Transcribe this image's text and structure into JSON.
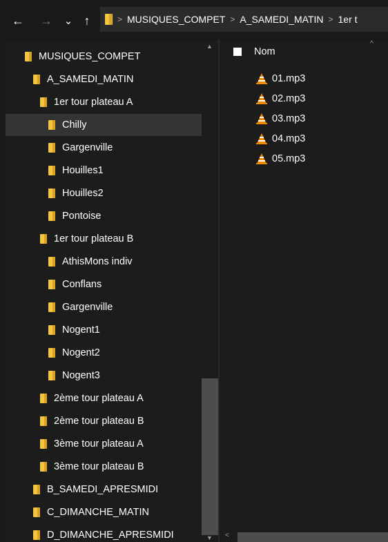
{
  "nav": {
    "back_icon": "←",
    "forward_icon": "→",
    "recent_icon": "⌄",
    "up_icon": "↑"
  },
  "breadcrumb": [
    {
      "label": "MUSIQUES_COMPET"
    },
    {
      "label": "A_SAMEDI_MATIN"
    },
    {
      "label": "1er t"
    }
  ],
  "tree": {
    "items": [
      {
        "label": "MUSIQUES_COMPET",
        "depth": 0,
        "selected": false
      },
      {
        "label": "A_SAMEDI_MATIN",
        "depth": 1,
        "selected": false
      },
      {
        "label": "1er tour plateau A",
        "depth": 2,
        "selected": false
      },
      {
        "label": "Chilly",
        "depth": 3,
        "selected": true
      },
      {
        "label": "Gargenville",
        "depth": 3,
        "selected": false
      },
      {
        "label": "Houilles1",
        "depth": 3,
        "selected": false
      },
      {
        "label": "Houilles2",
        "depth": 3,
        "selected": false
      },
      {
        "label": "Pontoise",
        "depth": 3,
        "selected": false
      },
      {
        "label": "1er tour plateau B",
        "depth": 2,
        "selected": false
      },
      {
        "label": "AthisMons indiv",
        "depth": 3,
        "selected": false
      },
      {
        "label": "Conflans",
        "depth": 3,
        "selected": false
      },
      {
        "label": "Gargenville",
        "depth": 3,
        "selected": false
      },
      {
        "label": "Nogent1",
        "depth": 3,
        "selected": false
      },
      {
        "label": "Nogent2",
        "depth": 3,
        "selected": false
      },
      {
        "label": "Nogent3",
        "depth": 3,
        "selected": false
      },
      {
        "label": "2ème tour plateau A",
        "depth": 2,
        "selected": false
      },
      {
        "label": "2ème tour plateau B",
        "depth": 2,
        "selected": false
      },
      {
        "label": "3ème tour plateau A",
        "depth": 2,
        "selected": false
      },
      {
        "label": "3ème tour plateau B",
        "depth": 2,
        "selected": false
      },
      {
        "label": "B_SAMEDI_APRESMIDI",
        "depth": 1,
        "selected": false
      },
      {
        "label": "C_DIMANCHE_MATIN",
        "depth": 1,
        "selected": false
      },
      {
        "label": "D_DIMANCHE_APRESMIDI",
        "depth": 1,
        "selected": false
      }
    ]
  },
  "files": {
    "column_name": "Nom",
    "items": [
      {
        "name": "01.mp3"
      },
      {
        "name": "02.mp3"
      },
      {
        "name": "03.mp3"
      },
      {
        "name": "04.mp3"
      },
      {
        "name": "05.mp3"
      }
    ]
  },
  "colors": {
    "background": "#191919",
    "pane": "#1c1c1c",
    "selection": "#343434",
    "folder": "#f4c542",
    "vlc_orange": "#f08a00"
  }
}
